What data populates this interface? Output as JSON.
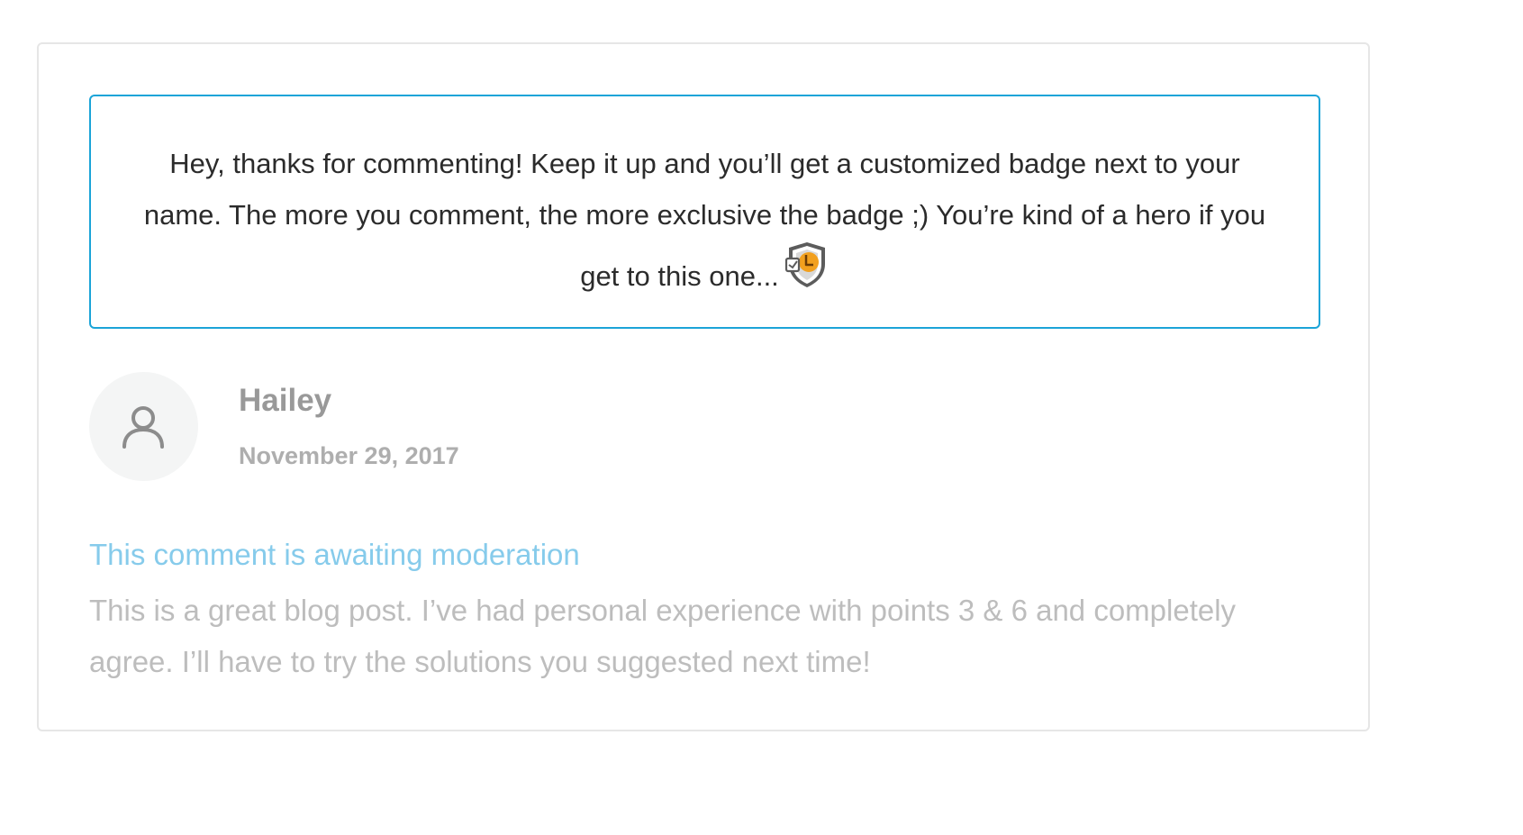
{
  "notice": {
    "text": "Hey, thanks for commenting! Keep it up and you’ll get a customized badge next to your name. The more you comment, the more exclusive the badge ;) You’re kind of a hero if you get to this one...",
    "badge_icon": "shield-badge-icon",
    "border_color": "#1ba4d8"
  },
  "comment": {
    "avatar_icon": "user-avatar-icon",
    "author": "Hailey",
    "date": "November 29, 2017",
    "moderation_note": "This comment is awaiting moderation",
    "body": "This is a great blog post. I’ve had personal experience with points 3 & 6 and completely agree. I’ll have to try the solutions you suggested next time!"
  },
  "colors": {
    "accent_light_blue": "#86cbeb",
    "name_gray": "#999999",
    "body_gray": "#bdbdbd"
  }
}
